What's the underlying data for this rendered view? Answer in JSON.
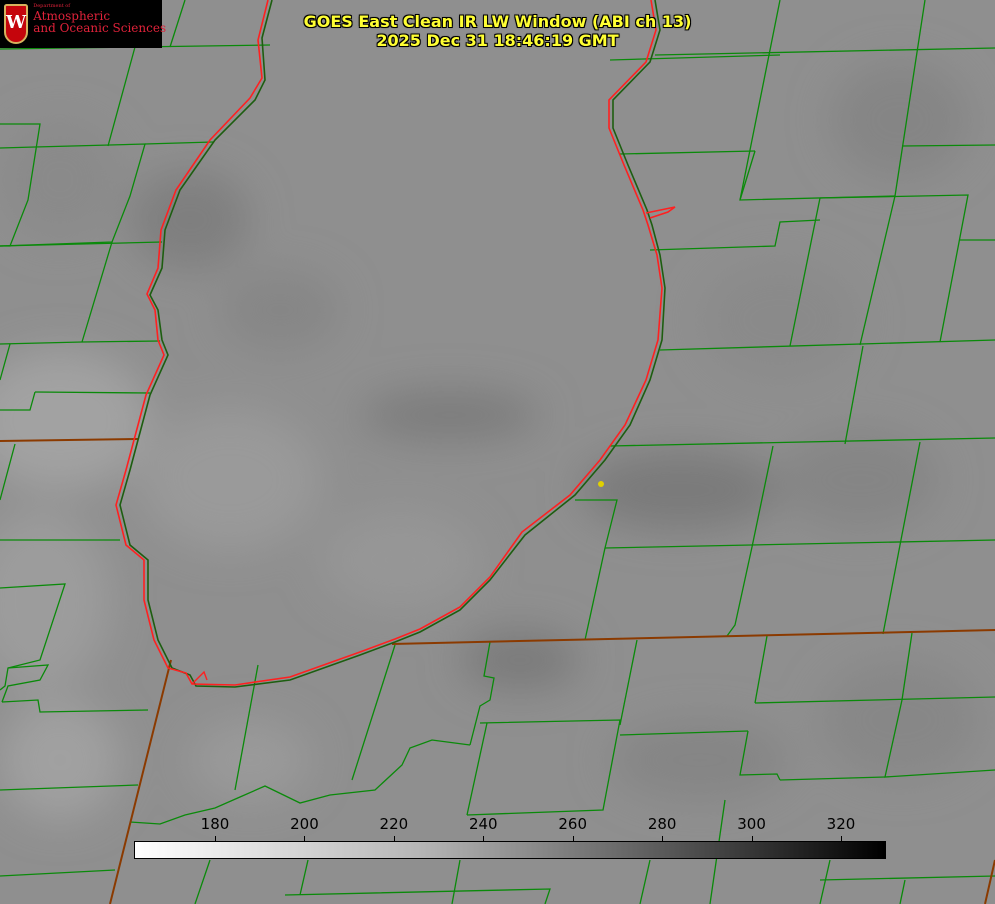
{
  "title": {
    "line1": "GOES East Clean IR LW Window (ABI ch 13)",
    "line2": "2025 Dec 31 18:46:19 GMT"
  },
  "logo": {
    "crest_letter": "W",
    "dept": "Department of",
    "line1": "Atmospheric",
    "line2": "and Oceanic Sciences",
    "colors": {
      "background": "#000000",
      "text": "#e0223a",
      "crest": "#c5050c"
    }
  },
  "colorbar": {
    "ticks": [
      {
        "label": "180",
        "value": 180
      },
      {
        "label": "200",
        "value": 200
      },
      {
        "label": "220",
        "value": 220
      },
      {
        "label": "240",
        "value": 240
      },
      {
        "label": "260",
        "value": 260
      },
      {
        "label": "280",
        "value": 280
      },
      {
        "label": "300",
        "value": 300
      },
      {
        "label": "320",
        "value": 320
      }
    ],
    "gradient": "white-to-black"
  },
  "colors": {
    "coastline": "#ff2020",
    "county_lines": "#0a8a0a",
    "state_lines": "#8b3a00",
    "point_marker": "#e0d000",
    "imagery_base": "#8f8f8f"
  }
}
